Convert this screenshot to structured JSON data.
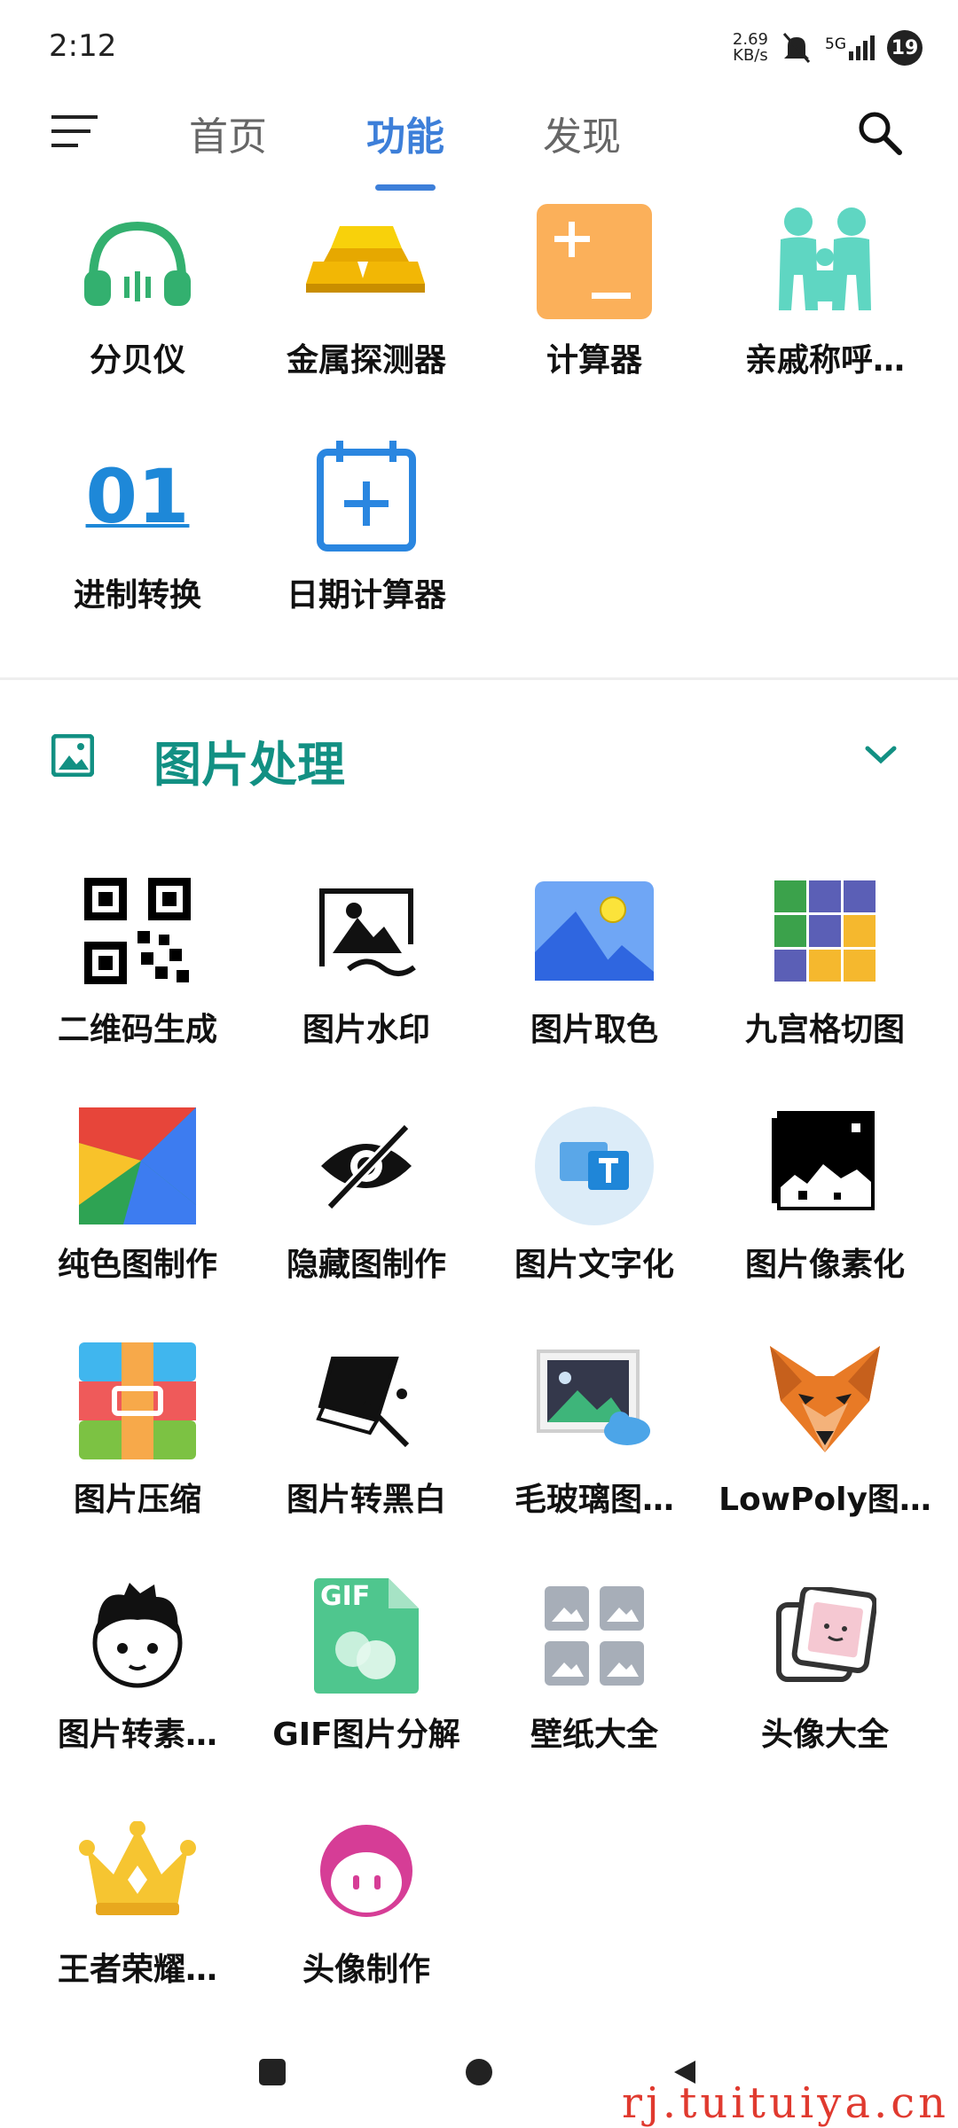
{
  "status": {
    "time": "2:12",
    "speed_value": "2.69",
    "speed_unit": "KB/s",
    "network": "5G",
    "badge": "19"
  },
  "tabs": [
    {
      "label": "首页"
    },
    {
      "label": "功能"
    },
    {
      "label": "发现"
    }
  ],
  "top_items": [
    {
      "label": "分贝仪",
      "icon": "headphones-icon"
    },
    {
      "label": "金属探测器",
      "icon": "gold-bars-icon"
    },
    {
      "label": "计算器",
      "icon": "calculator-icon"
    },
    {
      "label": "亲戚称呼…",
      "icon": "family-icon"
    },
    {
      "label": "进制转换",
      "icon": "binary-icon",
      "glyph": "01"
    },
    {
      "label": "日期计算器",
      "icon": "calendar-add-icon"
    }
  ],
  "section": {
    "title": "图片处理"
  },
  "image_items": [
    {
      "label": "二维码生成",
      "icon": "qr-code-icon"
    },
    {
      "label": "图片水印",
      "icon": "watermark-image-icon"
    },
    {
      "label": "图片取色",
      "icon": "landscape-icon"
    },
    {
      "label": "九宫格切图",
      "icon": "nine-grid-icon"
    },
    {
      "label": "纯色图制作",
      "icon": "color-blocks-icon"
    },
    {
      "label": "隐藏图制作",
      "icon": "eye-off-icon"
    },
    {
      "label": "图片文字化",
      "icon": "image-text-icon"
    },
    {
      "label": "图片像素化",
      "icon": "pixel-image-icon"
    },
    {
      "label": "图片压缩",
      "icon": "compress-archive-icon"
    },
    {
      "label": "图片转黑白",
      "icon": "paint-bucket-icon"
    },
    {
      "label": "毛玻璃图…",
      "icon": "picture-cloud-icon"
    },
    {
      "label": "LowPoly图…",
      "icon": "fox-icon"
    },
    {
      "label": "图片转素…",
      "icon": "sketch-face-icon"
    },
    {
      "label": "GIF图片分解",
      "icon": "gif-file-icon",
      "glyph": "GIF"
    },
    {
      "label": "壁纸大全",
      "icon": "wallpaper-grid-icon"
    },
    {
      "label": "头像大全",
      "icon": "avatar-cards-icon"
    },
    {
      "label": "王者荣耀…",
      "icon": "crown-icon"
    },
    {
      "label": "头像制作",
      "icon": "avatar-maker-icon"
    }
  ],
  "watermark": "rj.tuituiya.cn"
}
